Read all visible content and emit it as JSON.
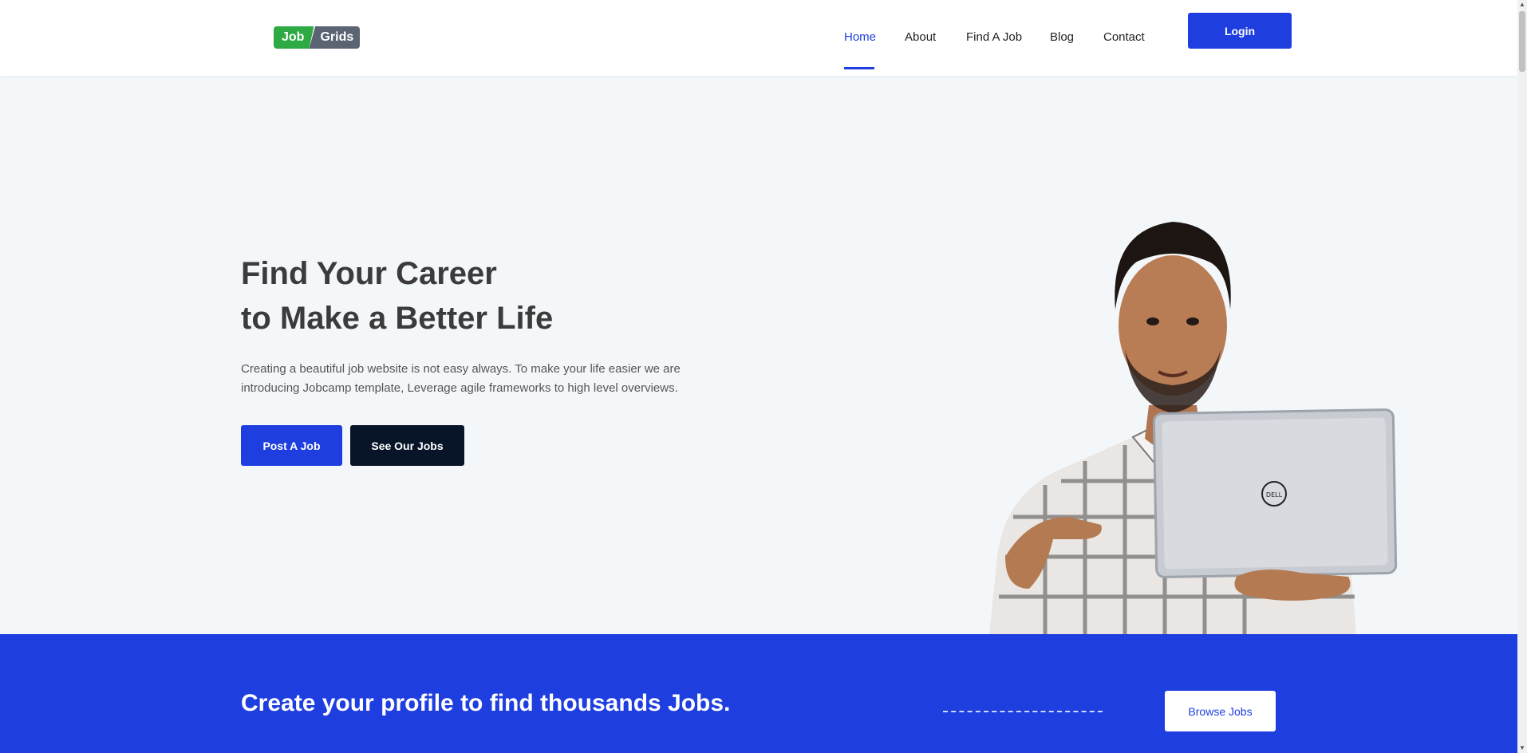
{
  "brand": {
    "logo_left": "Job",
    "logo_right": "Grids"
  },
  "nav": {
    "items": [
      {
        "label": "Home",
        "active": true
      },
      {
        "label": "About",
        "active": false
      },
      {
        "label": "Find A Job",
        "active": false
      },
      {
        "label": "Blog",
        "active": false
      },
      {
        "label": "Contact",
        "active": false
      }
    ],
    "login_label": "Login"
  },
  "hero": {
    "title_line1": "Find Your Career",
    "title_line2": "to Make a Better Life",
    "description": "Creating a beautiful job website is not easy always. To make your life easier we are introducing Jobcamp template, Leverage agile frameworks to high level overviews.",
    "post_job_label": "Post A Job",
    "see_jobs_label": "See Our Jobs",
    "laptop_brand": "DELL"
  },
  "banner": {
    "title": "Create your profile to find thousands Jobs.",
    "browse_label": "Browse Jobs"
  },
  "colors": {
    "primary": "#1e3ee0",
    "dark": "#081528",
    "logo_green": "#2eaa45",
    "logo_gray": "#5a6472",
    "hero_bg": "#f4f7fa"
  }
}
